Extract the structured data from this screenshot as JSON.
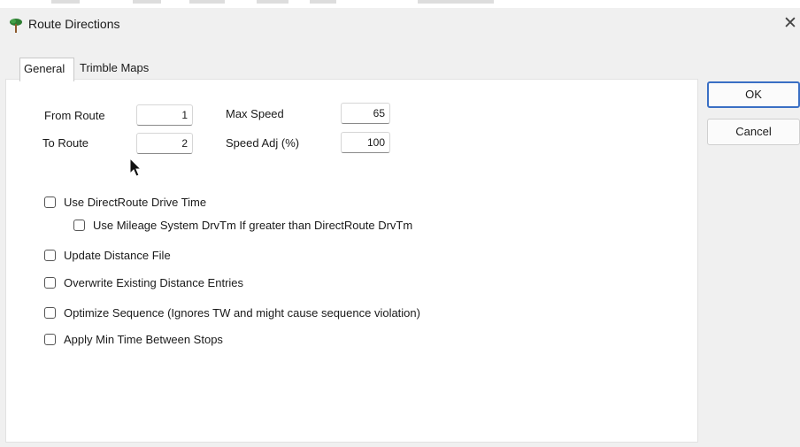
{
  "window": {
    "title": "Route Directions",
    "close_symbol": "✕",
    "icon": "route-tree-icon"
  },
  "tabs": [
    {
      "label": "General",
      "active": true
    },
    {
      "label": "Trimble Maps",
      "active": false
    }
  ],
  "fields": {
    "from_route": {
      "label": "From Route",
      "value": "1"
    },
    "to_route": {
      "label": "To Route",
      "value": "2"
    },
    "max_speed": {
      "label": "Max Speed",
      "value": "65"
    },
    "speed_adj": {
      "label": "Speed Adj (%)",
      "value": "100"
    }
  },
  "options": [
    {
      "label": "Use DirectRoute Drive Time",
      "checked": false
    },
    {
      "label": "Use Mileage System DrvTm If greater than DirectRoute DrvTm",
      "checked": false
    },
    {
      "label": "Update Distance File",
      "checked": false
    },
    {
      "label": "Overwrite Existing Distance Entries",
      "checked": false
    },
    {
      "label": "Optimize Sequence (Ignores TW and might cause sequence violation)",
      "checked": false
    },
    {
      "label": "Apply Min Time Between Stops",
      "checked": false
    }
  ],
  "buttons": {
    "ok": "OK",
    "cancel": "Cancel"
  },
  "colors": {
    "accent": "#3a6fc4",
    "panel_bg": "#ffffff",
    "window_bg": "#f0f0f0"
  }
}
